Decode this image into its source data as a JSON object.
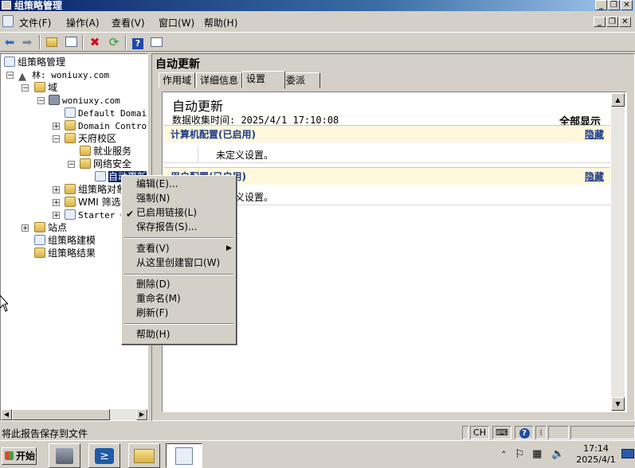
{
  "window": {
    "title": "组策略管理",
    "controls": {
      "minimize": "_",
      "restore": "❐",
      "close": "✕"
    }
  },
  "menu": [
    "文件(F)",
    "操作(A)",
    "查看(V)",
    "窗口(W)",
    "帮助(H)"
  ],
  "toolbar": {
    "icons": [
      "back-arrow-icon",
      "forward-arrow-icon",
      "up-folder-icon",
      "show-hide-tree-icon",
      "delete-icon",
      "refresh-icon",
      "help-icon",
      "properties-icon"
    ]
  },
  "tree": {
    "root": "组策略管理",
    "forest": "林: woniuxy.com",
    "domains": "域",
    "domain": "woniuxy.com",
    "default_policy": "Default Domain",
    "domain_controllers": "Domain Control",
    "ou_campus": "天府校区",
    "ou_employment": "就业服务",
    "ou_security": "网络安全",
    "gpo_link": "自动更新",
    "gpo_objects": "组策略对象",
    "wmi_filters": "WMI 筛选器",
    "starter_gpos": "Starter GPO",
    "sites": "站点",
    "modeling": "组策略建模",
    "results": "组策略结果"
  },
  "panel": {
    "title": "自动更新",
    "tabs": [
      "作用域",
      "详细信息",
      "设置",
      "委派"
    ],
    "active_tab": "设置"
  },
  "report": {
    "title": "自动更新",
    "collected": "数据收集时间: 2025/4/1 17:10:08",
    "show_all": "全部显示",
    "computer_section": "计算机配置(已启用)",
    "computer_hide": "隐藏",
    "computer_body": "未定义设置。",
    "user_section": "用户配置(已启用)",
    "user_hide": "隐藏",
    "user_body": "未定义设置。"
  },
  "context_menu": {
    "edit": "编辑(E)...",
    "enforce": "强制(N)",
    "link_enabled": "已启用链接(L)",
    "save_report": "保存报告(S)...",
    "view": "查看(V)",
    "new_window": "从这里创建窗口(W)",
    "delete": "删除(D)",
    "rename": "重命名(M)",
    "refresh": "刷新(F)",
    "help": "帮助(H)",
    "check": "✔",
    "submenu_arrow": "▶"
  },
  "status": {
    "text": "将此报告保存到文件",
    "ime": "CH"
  },
  "taskbar": {
    "start": "开始",
    "clock_time": "17:14",
    "clock_date": "2025/4/1"
  }
}
